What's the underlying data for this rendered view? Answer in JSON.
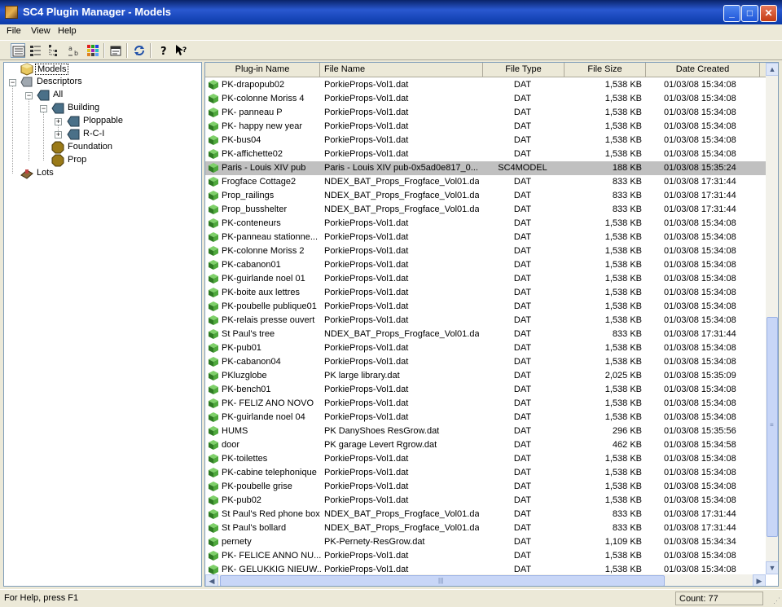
{
  "window": {
    "title": "SC4 Plugin Manager - Models",
    "minimize": "_",
    "maximize": "□",
    "close": "✕"
  },
  "menu": [
    "File",
    "View",
    "Help"
  ],
  "toolbar": [
    "large-icons-icon",
    "list-view-icon",
    "tree-view-icon",
    "small-icons-icon",
    "color-grid-icon",
    "properties-icon",
    "refresh-icon",
    "help-icon",
    "context-help-icon"
  ],
  "tree": {
    "models": "Models",
    "descriptors": "Descriptors",
    "all": "All",
    "building": "Building",
    "ploppable": "Ploppable",
    "rci": "R-C-I",
    "foundation": "Foundation",
    "prop": "Prop",
    "lots": "Lots"
  },
  "columns": {
    "name": "Plug-in Name",
    "file": "File Name",
    "type": "File Type",
    "size": "File Size",
    "date": "Date Created"
  },
  "rows": [
    {
      "name": "PK-drapopub02",
      "file": "PorkieProps-Vol1.dat",
      "type": "DAT",
      "size": "1,538 KB",
      "date": "01/03/08 15:34:08"
    },
    {
      "name": "PK-colonne Moriss 4",
      "file": "PorkieProps-Vol1.dat",
      "type": "DAT",
      "size": "1,538 KB",
      "date": "01/03/08 15:34:08"
    },
    {
      "name": "PK- panneau P",
      "file": "PorkieProps-Vol1.dat",
      "type": "DAT",
      "size": "1,538 KB",
      "date": "01/03/08 15:34:08"
    },
    {
      "name": "PK- happy new year",
      "file": "PorkieProps-Vol1.dat",
      "type": "DAT",
      "size": "1,538 KB",
      "date": "01/03/08 15:34:08"
    },
    {
      "name": "PK-bus04",
      "file": "PorkieProps-Vol1.dat",
      "type": "DAT",
      "size": "1,538 KB",
      "date": "01/03/08 15:34:08"
    },
    {
      "name": "PK-affichette02",
      "file": "PorkieProps-Vol1.dat",
      "type": "DAT",
      "size": "1,538 KB",
      "date": "01/03/08 15:34:08"
    },
    {
      "name": "Paris - Louis XIV pub",
      "file": "Paris - Louis XIV pub-0x5ad0e817_0...",
      "type": "SC4MODEL",
      "size": "188 KB",
      "date": "01/03/08 15:35:24",
      "selected": true
    },
    {
      "name": "Frogface Cottage2",
      "file": "NDEX_BAT_Props_Frogface_Vol01.dat",
      "type": "DAT",
      "size": "833 KB",
      "date": "01/03/08 17:31:44"
    },
    {
      "name": "Prop_railings",
      "file": "NDEX_BAT_Props_Frogface_Vol01.dat",
      "type": "DAT",
      "size": "833 KB",
      "date": "01/03/08 17:31:44"
    },
    {
      "name": "Prop_busshelter",
      "file": "NDEX_BAT_Props_Frogface_Vol01.dat",
      "type": "DAT",
      "size": "833 KB",
      "date": "01/03/08 17:31:44"
    },
    {
      "name": "PK-conteneurs",
      "file": "PorkieProps-Vol1.dat",
      "type": "DAT",
      "size": "1,538 KB",
      "date": "01/03/08 15:34:08"
    },
    {
      "name": "PK-panneau stationne...",
      "file": "PorkieProps-Vol1.dat",
      "type": "DAT",
      "size": "1,538 KB",
      "date": "01/03/08 15:34:08"
    },
    {
      "name": "PK-colonne Moriss 2",
      "file": "PorkieProps-Vol1.dat",
      "type": "DAT",
      "size": "1,538 KB",
      "date": "01/03/08 15:34:08"
    },
    {
      "name": "PK-cabanon01",
      "file": "PorkieProps-Vol1.dat",
      "type": "DAT",
      "size": "1,538 KB",
      "date": "01/03/08 15:34:08"
    },
    {
      "name": "PK-guirlande noel 01",
      "file": "PorkieProps-Vol1.dat",
      "type": "DAT",
      "size": "1,538 KB",
      "date": "01/03/08 15:34:08"
    },
    {
      "name": "PK-boite aux lettres",
      "file": "PorkieProps-Vol1.dat",
      "type": "DAT",
      "size": "1,538 KB",
      "date": "01/03/08 15:34:08"
    },
    {
      "name": "PK-poubelle publique01",
      "file": "PorkieProps-Vol1.dat",
      "type": "DAT",
      "size": "1,538 KB",
      "date": "01/03/08 15:34:08"
    },
    {
      "name": "PK-relais presse ouvert",
      "file": "PorkieProps-Vol1.dat",
      "type": "DAT",
      "size": "1,538 KB",
      "date": "01/03/08 15:34:08"
    },
    {
      "name": "St Paul's tree",
      "file": "NDEX_BAT_Props_Frogface_Vol01.dat",
      "type": "DAT",
      "size": "833 KB",
      "date": "01/03/08 17:31:44"
    },
    {
      "name": "PK-pub01",
      "file": "PorkieProps-Vol1.dat",
      "type": "DAT",
      "size": "1,538 KB",
      "date": "01/03/08 15:34:08"
    },
    {
      "name": "PK-cabanon04",
      "file": "PorkieProps-Vol1.dat",
      "type": "DAT",
      "size": "1,538 KB",
      "date": "01/03/08 15:34:08"
    },
    {
      "name": "PKluzglobe",
      "file": "PK large library.dat",
      "type": "DAT",
      "size": "2,025 KB",
      "date": "01/03/08 15:35:09"
    },
    {
      "name": "PK-bench01",
      "file": "PorkieProps-Vol1.dat",
      "type": "DAT",
      "size": "1,538 KB",
      "date": "01/03/08 15:34:08"
    },
    {
      "name": "PK- FELIZ ANO NOVO",
      "file": "PorkieProps-Vol1.dat",
      "type": "DAT",
      "size": "1,538 KB",
      "date": "01/03/08 15:34:08"
    },
    {
      "name": "PK-guirlande noel 04",
      "file": "PorkieProps-Vol1.dat",
      "type": "DAT",
      "size": "1,538 KB",
      "date": "01/03/08 15:34:08"
    },
    {
      "name": "HUMS",
      "file": "PK DanyShoes ResGrow.dat",
      "type": "DAT",
      "size": "296 KB",
      "date": "01/03/08 15:35:56"
    },
    {
      "name": "door",
      "file": "PK garage Levert Rgrow.dat",
      "type": "DAT",
      "size": "462 KB",
      "date": "01/03/08 15:34:58"
    },
    {
      "name": "PK-toilettes",
      "file": "PorkieProps-Vol1.dat",
      "type": "DAT",
      "size": "1,538 KB",
      "date": "01/03/08 15:34:08"
    },
    {
      "name": "PK-cabine telephonique",
      "file": "PorkieProps-Vol1.dat",
      "type": "DAT",
      "size": "1,538 KB",
      "date": "01/03/08 15:34:08"
    },
    {
      "name": "PK-poubelle grise",
      "file": "PorkieProps-Vol1.dat",
      "type": "DAT",
      "size": "1,538 KB",
      "date": "01/03/08 15:34:08"
    },
    {
      "name": "PK-pub02",
      "file": "PorkieProps-Vol1.dat",
      "type": "DAT",
      "size": "1,538 KB",
      "date": "01/03/08 15:34:08"
    },
    {
      "name": "St Paul's Red phone box",
      "file": "NDEX_BAT_Props_Frogface_Vol01.dat",
      "type": "DAT",
      "size": "833 KB",
      "date": "01/03/08 17:31:44"
    },
    {
      "name": "St Paul's bollard",
      "file": "NDEX_BAT_Props_Frogface_Vol01.dat",
      "type": "DAT",
      "size": "833 KB",
      "date": "01/03/08 17:31:44"
    },
    {
      "name": "pernety",
      "file": "PK-Pernety-ResGrow.dat",
      "type": "DAT",
      "size": "1,109 KB",
      "date": "01/03/08 15:34:34"
    },
    {
      "name": "PK- FELICE ANNO NU...",
      "file": "PorkieProps-Vol1.dat",
      "type": "DAT",
      "size": "1,538 KB",
      "date": "01/03/08 15:34:08"
    },
    {
      "name": "PK- GELUKKIG NIEUW...",
      "file": "PorkieProps-Vol1.dat",
      "type": "DAT",
      "size": "1,538 KB",
      "date": "01/03/08 15:34:08"
    }
  ],
  "status": {
    "help": "For Help, press F1",
    "count": "Count: 77"
  },
  "colors": {
    "titlebar": "#0a3aa8",
    "selected_row": "#c0c0c0",
    "prop_icon": "#3a8a2a"
  }
}
